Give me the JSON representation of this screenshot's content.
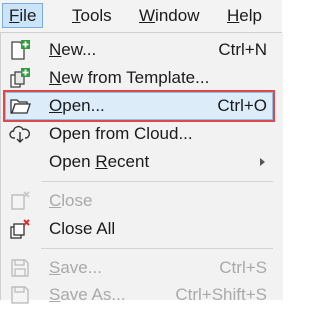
{
  "menubar": {
    "items": [
      {
        "label": "File",
        "mnemonic": "F",
        "rest": "ile"
      },
      {
        "label": "Tools",
        "mnemonic": "T",
        "rest": "ools"
      },
      {
        "label": "Window",
        "mnemonic": "W",
        "rest": "indow"
      },
      {
        "label": "Help",
        "mnemonic": "H",
        "rest": "elp"
      }
    ]
  },
  "file_menu": {
    "items": [
      {
        "label": "New...",
        "mnemonic": "N",
        "rest": "ew...",
        "shortcut": "Ctrl+N",
        "icon": "new-document-icon"
      },
      {
        "label": "New from Template...",
        "mnemonic": "N",
        "rest": "ew from Template...",
        "shortcut": "",
        "icon": "new-from-template-icon"
      },
      {
        "label": "Open...",
        "mnemonic": "O",
        "rest": "pen...",
        "shortcut": "Ctrl+O",
        "icon": "open-folder-icon"
      },
      {
        "label": "Open from Cloud...",
        "shortcut": "",
        "icon": "cloud-download-icon"
      },
      {
        "label": "Open Recent",
        "mnemonic": "R",
        "pre": "Open ",
        "rest": "ecent",
        "shortcut": "",
        "icon": ""
      },
      {
        "label": "Close",
        "mnemonic": "C",
        "rest": "lose",
        "shortcut": "",
        "icon": "close-document-icon"
      },
      {
        "label": "Close All",
        "shortcut": "",
        "icon": "close-all-icon"
      },
      {
        "label": "Save...",
        "mnemonic": "S",
        "rest": "ave...",
        "shortcut": "Ctrl+S",
        "icon": "save-icon"
      },
      {
        "label": "Save As...",
        "mnemonic": "S",
        "rest": "ave As...",
        "shortcut": "Ctrl+Shift+S",
        "icon": "save-as-icon"
      }
    ]
  },
  "colors": {
    "accent_highlight": "#dcecf9",
    "highlight_outline": "#e0474a",
    "new_icon_green": "#2e9e3e",
    "close_icon_red": "#d9302f",
    "disabled_text": "#a9a9a9"
  }
}
